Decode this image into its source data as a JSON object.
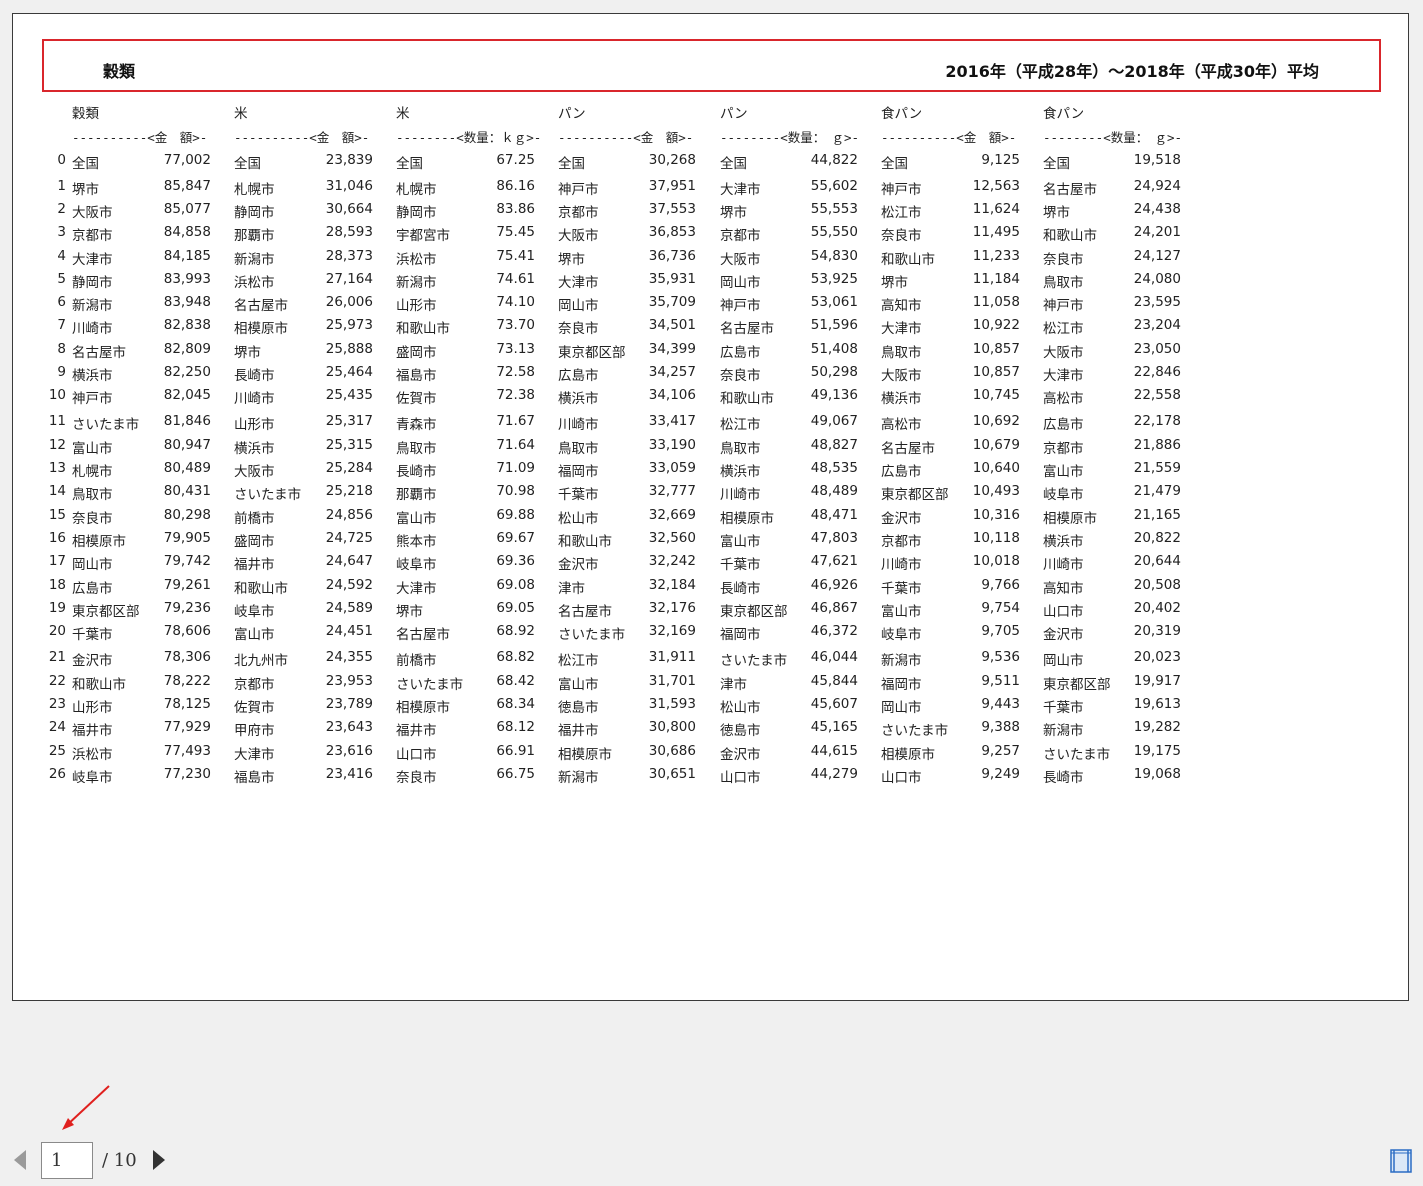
{
  "title": {
    "left": "穀類",
    "right": "2016年（平成28年）〜2018年（平成30年）平均"
  },
  "columns": [
    {
      "name": "穀類",
      "sub": "----------<金　額>-"
    },
    {
      "name": "米",
      "sub": "----------<金　額>-"
    },
    {
      "name": "米",
      "sub": "--------<数量：ｋｇ>-"
    },
    {
      "name": "パン",
      "sub": "----------<金　額>-"
    },
    {
      "name": "パン",
      "sub": "--------<数量：　ｇ>-"
    },
    {
      "name": "食パン",
      "sub": "----------<金　額>-"
    },
    {
      "name": "食パン",
      "sub": "--------<数量：　ｇ>-"
    }
  ],
  "rows": [
    [
      "0",
      [
        "全国",
        "77,002"
      ],
      [
        "全国",
        "23,839"
      ],
      [
        "全国",
        "67.25"
      ],
      [
        "全国",
        "30,268"
      ],
      [
        "全国",
        "44,822"
      ],
      [
        "全国",
        "9,125"
      ],
      [
        "全国",
        "19,518"
      ]
    ],
    [
      "1",
      [
        "堺市",
        "85,847"
      ],
      [
        "札幌市",
        "31,046"
      ],
      [
        "札幌市",
        "86.16"
      ],
      [
        "神戸市",
        "37,951"
      ],
      [
        "大津市",
        "55,602"
      ],
      [
        "神戸市",
        "12,563"
      ],
      [
        "名古屋市",
        "24,924"
      ]
    ],
    [
      "2",
      [
        "大阪市",
        "85,077"
      ],
      [
        "静岡市",
        "30,664"
      ],
      [
        "静岡市",
        "83.86"
      ],
      [
        "京都市",
        "37,553"
      ],
      [
        "堺市",
        "55,553"
      ],
      [
        "松江市",
        "11,624"
      ],
      [
        "堺市",
        "24,438"
      ]
    ],
    [
      "3",
      [
        "京都市",
        "84,858"
      ],
      [
        "那覇市",
        "28,593"
      ],
      [
        "宇都宮市",
        "75.45"
      ],
      [
        "大阪市",
        "36,853"
      ],
      [
        "京都市",
        "55,550"
      ],
      [
        "奈良市",
        "11,495"
      ],
      [
        "和歌山市",
        "24,201"
      ]
    ],
    [
      "4",
      [
        "大津市",
        "84,185"
      ],
      [
        "新潟市",
        "28,373"
      ],
      [
        "浜松市",
        "75.41"
      ],
      [
        "堺市",
        "36,736"
      ],
      [
        "大阪市",
        "54,830"
      ],
      [
        "和歌山市",
        "11,233"
      ],
      [
        "奈良市",
        "24,127"
      ]
    ],
    [
      "5",
      [
        "静岡市",
        "83,993"
      ],
      [
        "浜松市",
        "27,164"
      ],
      [
        "新潟市",
        "74.61"
      ],
      [
        "大津市",
        "35,931"
      ],
      [
        "岡山市",
        "53,925"
      ],
      [
        "堺市",
        "11,184"
      ],
      [
        "鳥取市",
        "24,080"
      ]
    ],
    [
      "6",
      [
        "新潟市",
        "83,948"
      ],
      [
        "名古屋市",
        "26,006"
      ],
      [
        "山形市",
        "74.10"
      ],
      [
        "岡山市",
        "35,709"
      ],
      [
        "神戸市",
        "53,061"
      ],
      [
        "高知市",
        "11,058"
      ],
      [
        "神戸市",
        "23,595"
      ]
    ],
    [
      "7",
      [
        "川崎市",
        "82,838"
      ],
      [
        "相模原市",
        "25,973"
      ],
      [
        "和歌山市",
        "73.70"
      ],
      [
        "奈良市",
        "34,501"
      ],
      [
        "名古屋市",
        "51,596"
      ],
      [
        "大津市",
        "10,922"
      ],
      [
        "松江市",
        "23,204"
      ]
    ],
    [
      "8",
      [
        "名古屋市",
        "82,809"
      ],
      [
        "堺市",
        "25,888"
      ],
      [
        "盛岡市",
        "73.13"
      ],
      [
        "東京都区部",
        "34,399"
      ],
      [
        "広島市",
        "51,408"
      ],
      [
        "鳥取市",
        "10,857"
      ],
      [
        "大阪市",
        "23,050"
      ]
    ],
    [
      "9",
      [
        "横浜市",
        "82,250"
      ],
      [
        "長崎市",
        "25,464"
      ],
      [
        "福島市",
        "72.58"
      ],
      [
        "広島市",
        "34,257"
      ],
      [
        "奈良市",
        "50,298"
      ],
      [
        "大阪市",
        "10,857"
      ],
      [
        "大津市",
        "22,846"
      ]
    ],
    [
      "10",
      [
        "神戸市",
        "82,045"
      ],
      [
        "川崎市",
        "25,435"
      ],
      [
        "佐賀市",
        "72.38"
      ],
      [
        "横浜市",
        "34,106"
      ],
      [
        "和歌山市",
        "49,136"
      ],
      [
        "横浜市",
        "10,745"
      ],
      [
        "高松市",
        "22,558"
      ]
    ],
    [
      "11",
      [
        "さいたま市",
        "81,846"
      ],
      [
        "山形市",
        "25,317"
      ],
      [
        "青森市",
        "71.67"
      ],
      [
        "川崎市",
        "33,417"
      ],
      [
        "松江市",
        "49,067"
      ],
      [
        "高松市",
        "10,692"
      ],
      [
        "広島市",
        "22,178"
      ]
    ],
    [
      "12",
      [
        "富山市",
        "80,947"
      ],
      [
        "横浜市",
        "25,315"
      ],
      [
        "鳥取市",
        "71.64"
      ],
      [
        "鳥取市",
        "33,190"
      ],
      [
        "鳥取市",
        "48,827"
      ],
      [
        "名古屋市",
        "10,679"
      ],
      [
        "京都市",
        "21,886"
      ]
    ],
    [
      "13",
      [
        "札幌市",
        "80,489"
      ],
      [
        "大阪市",
        "25,284"
      ],
      [
        "長崎市",
        "71.09"
      ],
      [
        "福岡市",
        "33,059"
      ],
      [
        "横浜市",
        "48,535"
      ],
      [
        "広島市",
        "10,640"
      ],
      [
        "富山市",
        "21,559"
      ]
    ],
    [
      "14",
      [
        "鳥取市",
        "80,431"
      ],
      [
        "さいたま市",
        "25,218"
      ],
      [
        "那覇市",
        "70.98"
      ],
      [
        "千葉市",
        "32,777"
      ],
      [
        "川崎市",
        "48,489"
      ],
      [
        "東京都区部",
        "10,493"
      ],
      [
        "岐阜市",
        "21,479"
      ]
    ],
    [
      "15",
      [
        "奈良市",
        "80,298"
      ],
      [
        "前橋市",
        "24,856"
      ],
      [
        "富山市",
        "69.88"
      ],
      [
        "松山市",
        "32,669"
      ],
      [
        "相模原市",
        "48,471"
      ],
      [
        "金沢市",
        "10,316"
      ],
      [
        "相模原市",
        "21,165"
      ]
    ],
    [
      "16",
      [
        "相模原市",
        "79,905"
      ],
      [
        "盛岡市",
        "24,725"
      ],
      [
        "熊本市",
        "69.67"
      ],
      [
        "和歌山市",
        "32,560"
      ],
      [
        "富山市",
        "47,803"
      ],
      [
        "京都市",
        "10,118"
      ],
      [
        "横浜市",
        "20,822"
      ]
    ],
    [
      "17",
      [
        "岡山市",
        "79,742"
      ],
      [
        "福井市",
        "24,647"
      ],
      [
        "岐阜市",
        "69.36"
      ],
      [
        "金沢市",
        "32,242"
      ],
      [
        "千葉市",
        "47,621"
      ],
      [
        "川崎市",
        "10,018"
      ],
      [
        "川崎市",
        "20,644"
      ]
    ],
    [
      "18",
      [
        "広島市",
        "79,261"
      ],
      [
        "和歌山市",
        "24,592"
      ],
      [
        "大津市",
        "69.08"
      ],
      [
        "津市",
        "32,184"
      ],
      [
        "長崎市",
        "46,926"
      ],
      [
        "千葉市",
        "9,766"
      ],
      [
        "高知市",
        "20,508"
      ]
    ],
    [
      "19",
      [
        "東京都区部",
        "79,236"
      ],
      [
        "岐阜市",
        "24,589"
      ],
      [
        "堺市",
        "69.05"
      ],
      [
        "名古屋市",
        "32,176"
      ],
      [
        "東京都区部",
        "46,867"
      ],
      [
        "富山市",
        "9,754"
      ],
      [
        "山口市",
        "20,402"
      ]
    ],
    [
      "20",
      [
        "千葉市",
        "78,606"
      ],
      [
        "富山市",
        "24,451"
      ],
      [
        "名古屋市",
        "68.92"
      ],
      [
        "さいたま市",
        "32,169"
      ],
      [
        "福岡市",
        "46,372"
      ],
      [
        "岐阜市",
        "9,705"
      ],
      [
        "金沢市",
        "20,319"
      ]
    ],
    [
      "21",
      [
        "金沢市",
        "78,306"
      ],
      [
        "北九州市",
        "24,355"
      ],
      [
        "前橋市",
        "68.82"
      ],
      [
        "松江市",
        "31,911"
      ],
      [
        "さいたま市",
        "46,044"
      ],
      [
        "新潟市",
        "9,536"
      ],
      [
        "岡山市",
        "20,023"
      ]
    ],
    [
      "22",
      [
        "和歌山市",
        "78,222"
      ],
      [
        "京都市",
        "23,953"
      ],
      [
        "さいたま市",
        "68.42"
      ],
      [
        "富山市",
        "31,701"
      ],
      [
        "津市",
        "45,844"
      ],
      [
        "福岡市",
        "9,511"
      ],
      [
        "東京都区部",
        "19,917"
      ]
    ],
    [
      "23",
      [
        "山形市",
        "78,125"
      ],
      [
        "佐賀市",
        "23,789"
      ],
      [
        "相模原市",
        "68.34"
      ],
      [
        "徳島市",
        "31,593"
      ],
      [
        "松山市",
        "45,607"
      ],
      [
        "岡山市",
        "9,443"
      ],
      [
        "千葉市",
        "19,613"
      ]
    ],
    [
      "24",
      [
        "福井市",
        "77,929"
      ],
      [
        "甲府市",
        "23,643"
      ],
      [
        "福井市",
        "68.12"
      ],
      [
        "福井市",
        "30,800"
      ],
      [
        "徳島市",
        "45,165"
      ],
      [
        "さいたま市",
        "9,388"
      ],
      [
        "新潟市",
        "19,282"
      ]
    ],
    [
      "25",
      [
        "浜松市",
        "77,493"
      ],
      [
        "大津市",
        "23,616"
      ],
      [
        "山口市",
        "66.91"
      ],
      [
        "相模原市",
        "30,686"
      ],
      [
        "金沢市",
        "44,615"
      ],
      [
        "相模原市",
        "9,257"
      ],
      [
        "さいたま市",
        "19,175"
      ]
    ],
    [
      "26",
      [
        "岐阜市",
        "77,230"
      ],
      [
        "福島市",
        "23,416"
      ],
      [
        "奈良市",
        "66.75"
      ],
      [
        "新潟市",
        "30,651"
      ],
      [
        "山口市",
        "44,279"
      ],
      [
        "山口市",
        "9,249"
      ],
      [
        "長崎市",
        "19,068"
      ]
    ]
  ],
  "pager": {
    "current": "1",
    "total": "/ 10"
  },
  "icons": {
    "prev": "triangle-left-icon",
    "next": "triangle-right-icon",
    "layout": "page-layout-icon",
    "annotation": "red-arrow-icon"
  },
  "colors": {
    "title_border": "#d9262c",
    "annotation_arrow": "#e0201e",
    "layout_icon": "#2b6cc4"
  }
}
